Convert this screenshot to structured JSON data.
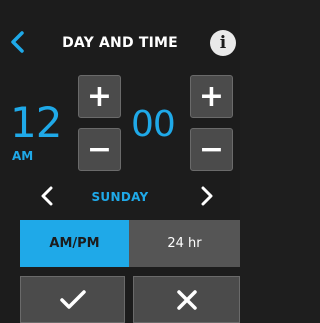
{
  "header": {
    "title": "DAY AND TIME",
    "info_label": "i"
  },
  "time": {
    "hour": "12",
    "period": "AM",
    "minute": "00",
    "plus_label": "+",
    "minus_label": "−"
  },
  "day": {
    "label": "SUNDAY"
  },
  "format": {
    "ampm_label": "AM/PM",
    "h24_label": "24 hr",
    "selected": "AM/PM"
  },
  "colors": {
    "accent": "#1fa9e8",
    "background": "#1c1c1c",
    "button": "#4b4b4b",
    "inactive_toggle": "#555555"
  },
  "icons": {
    "back": "chevron-left-icon",
    "info": "info-icon",
    "prev_day": "chevron-left-icon",
    "next_day": "chevron-right-icon",
    "confirm": "checkmark-icon",
    "cancel": "close-icon"
  }
}
